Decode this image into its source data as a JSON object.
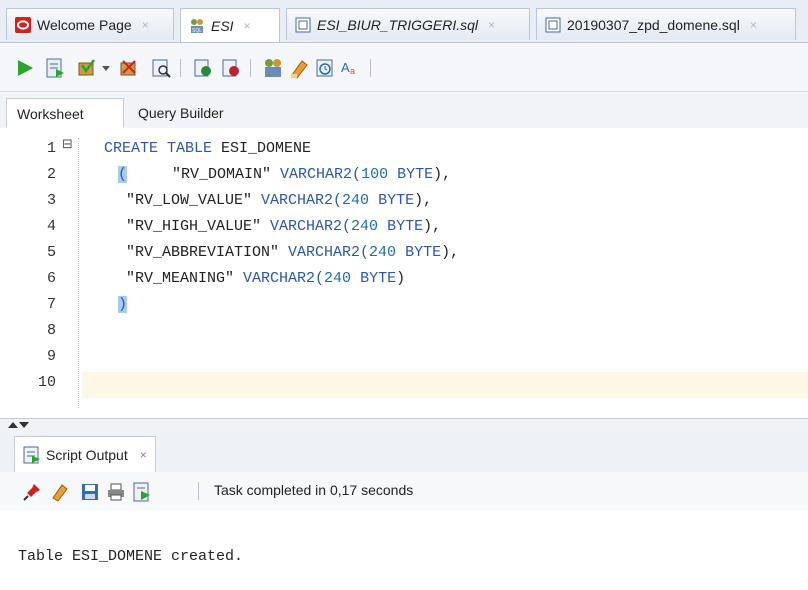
{
  "tabs": [
    {
      "label": "Welcome Page",
      "icon": "oracle-icon",
      "italic": false,
      "active": false
    },
    {
      "label": "ESI",
      "icon": "sql-connection-icon",
      "italic": true,
      "active": true
    },
    {
      "label": "ESI_BIUR_TRIGGERI.sql",
      "icon": "sql-file-icon",
      "italic": true,
      "active": false
    },
    {
      "label": "20190307_zpd_domene.sql",
      "icon": "sql-file-icon",
      "italic": false,
      "active": false
    }
  ],
  "tab_close_glyph": "×",
  "toolbar": {
    "icons": [
      "run-statement-icon",
      "run-script-icon",
      "commit-icon",
      "dropdown-icon",
      "rollback-icon",
      "explain-plan-icon",
      "autotrace-icon",
      "sql-tuning-icon",
      "clear-icon",
      "history-icon",
      "format-icon"
    ]
  },
  "worksheet_tabs": {
    "worksheet": "Worksheet",
    "query_builder": "Query Builder"
  },
  "editor": {
    "line_numbers": [
      "1",
      "2",
      "3",
      "4",
      "5",
      "6",
      "7",
      "8",
      "9",
      "10"
    ],
    "fold_glyph": "⊟",
    "lines": [
      [
        {
          "t": "CREATE TABLE ",
          "c": "kw"
        },
        {
          "t": "ESI_DOMENE",
          "c": "str"
        }
      ],
      [
        {
          "t": "(",
          "c": "paren"
        },
        {
          "t": "     \"RV_DOMAIN\" ",
          "c": "str"
        },
        {
          "t": "VARCHAR2(",
          "c": "kw"
        },
        {
          "t": "100 ",
          "c": "num"
        },
        {
          "t": "BYTE",
          "c": "kw"
        },
        {
          "t": "),",
          "c": "str"
        }
      ],
      [
        {
          "t": "\"RV_LOW_VALUE\" ",
          "c": "str"
        },
        {
          "t": "VARCHAR2(",
          "c": "kw"
        },
        {
          "t": "240 ",
          "c": "num"
        },
        {
          "t": "BYTE",
          "c": "kw"
        },
        {
          "t": "),",
          "c": "str"
        }
      ],
      [
        {
          "t": "\"RV_HIGH_VALUE\" ",
          "c": "str"
        },
        {
          "t": "VARCHAR2(",
          "c": "kw"
        },
        {
          "t": "240 ",
          "c": "num"
        },
        {
          "t": "BYTE",
          "c": "kw"
        },
        {
          "t": "),",
          "c": "str"
        }
      ],
      [
        {
          "t": "\"RV_ABBREVIATION\" ",
          "c": "str"
        },
        {
          "t": "VARCHAR2(",
          "c": "kw"
        },
        {
          "t": "240 ",
          "c": "num"
        },
        {
          "t": "BYTE",
          "c": "kw"
        },
        {
          "t": "),",
          "c": "str"
        }
      ],
      [
        {
          "t": "\"RV_MEANING\" ",
          "c": "str"
        },
        {
          "t": "VARCHAR2(",
          "c": "kw"
        },
        {
          "t": "240 ",
          "c": "num"
        },
        {
          "t": "BYTE",
          "c": "kw"
        },
        {
          "t": ")",
          "c": "str"
        }
      ],
      [
        {
          "t": ")",
          "c": "paren"
        }
      ],
      [],
      [],
      []
    ]
  },
  "output": {
    "tab_label": "Script Output",
    "tab_close": "×",
    "status": "Task completed in 0,17 seconds",
    "text": "Table ESI_DOMENE created."
  }
}
